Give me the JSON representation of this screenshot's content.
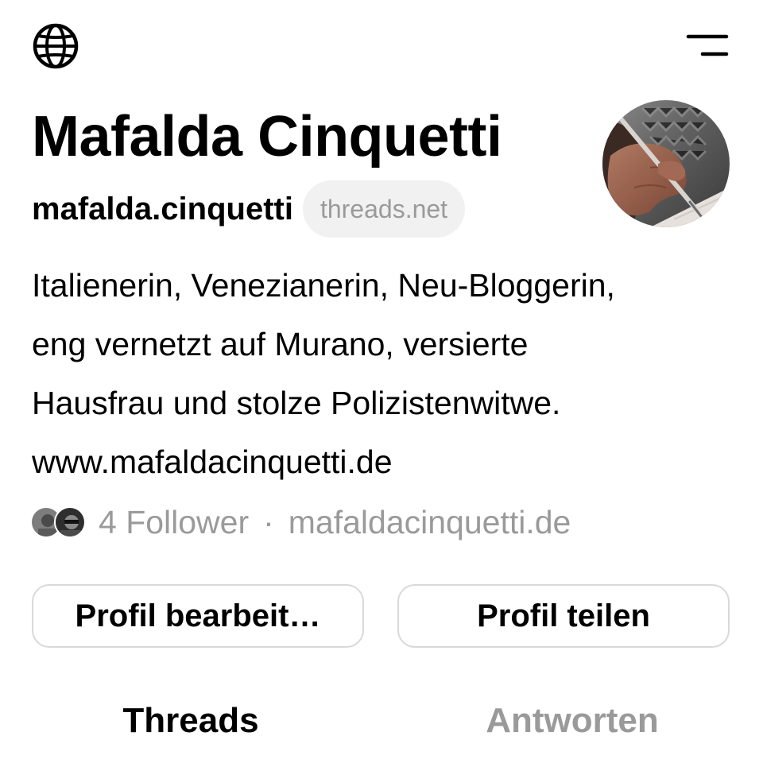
{
  "header": {
    "globe_icon": "globe-icon",
    "menu_icon": "menu-icon"
  },
  "profile": {
    "name": "Mafalda Cinquetti",
    "handle": "mafalda.cinquetti",
    "domain_badge": "threads.net",
    "avatar": "avatar-photo-hand-writing",
    "bio": [
      "Italienerin, Venezianerin, Neu-Bloggerin,",
      "eng vernetzt auf Murano, versierte",
      "Hausfrau und stolze Polizistenwitwe.",
      "www.mafaldacinquetti.de"
    ],
    "followers_text": "4 Follower",
    "separator": "·",
    "link_text": "mafaldacinquetti.de"
  },
  "actions": {
    "edit_label": "Profil bearbeit…",
    "share_label": "Profil teilen"
  },
  "tabs": [
    {
      "label": "Threads",
      "active": true
    },
    {
      "label": "Antworten",
      "active": false
    }
  ],
  "colors": {
    "text": "#000000",
    "muted": "#9a9a9a",
    "border": "#d9d9d9",
    "pill_bg": "#f1f1f1"
  }
}
